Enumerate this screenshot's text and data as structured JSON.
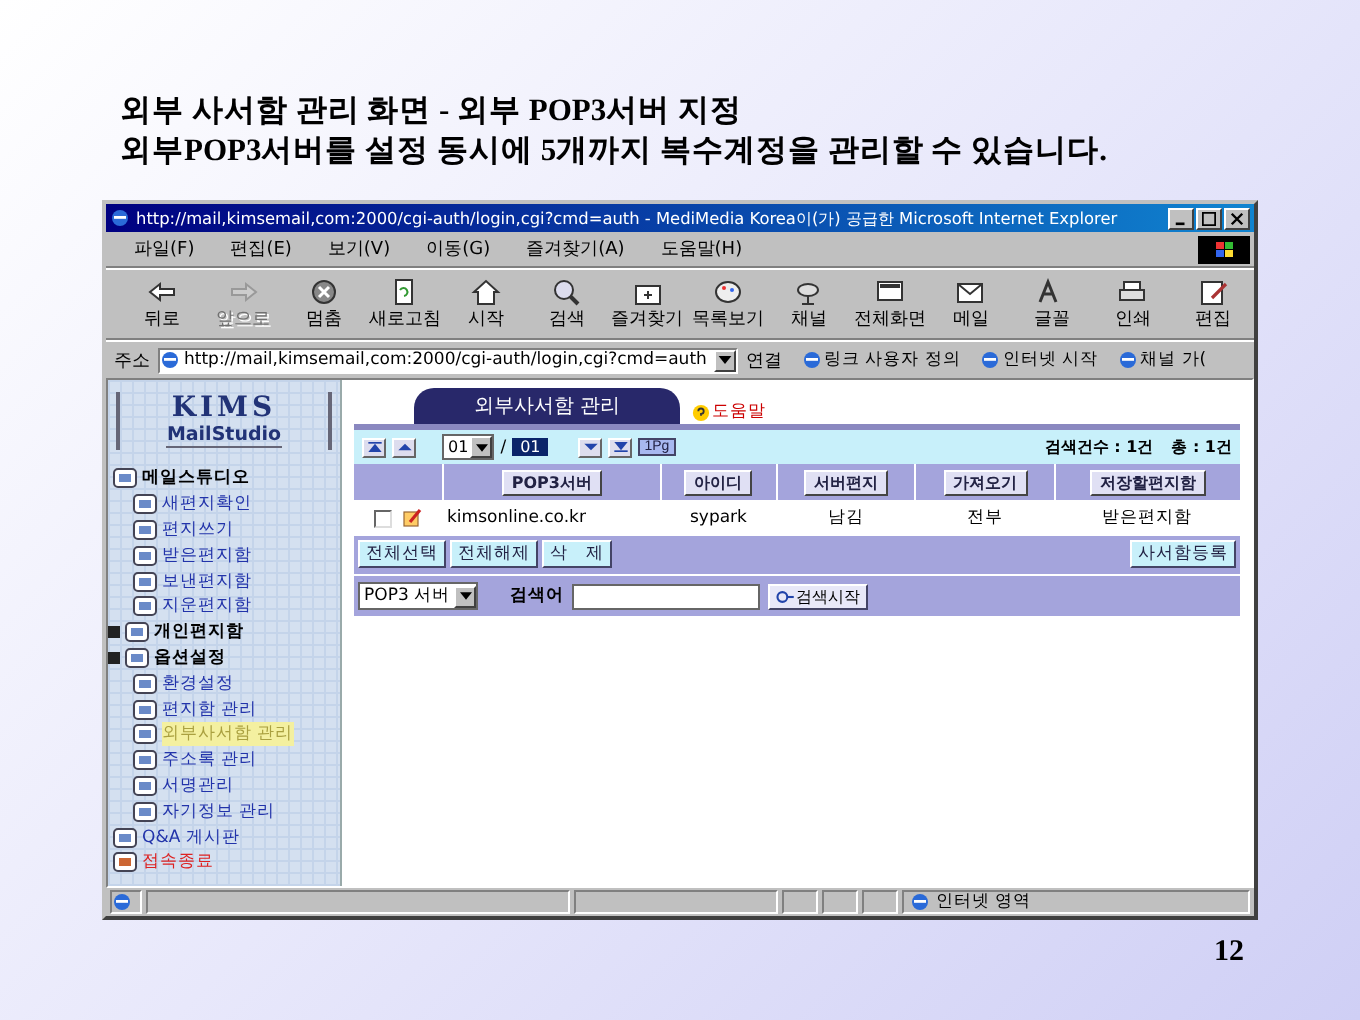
{
  "slide": {
    "title_lines": [
      "외부 사서함 관리 화면 - 외부 POP3서버 지정",
      "외부POP3서버를 설정 동시에 5개까지 복수계정을 관리할 수 있습니다."
    ],
    "page_number": "12"
  },
  "window": {
    "title": "http://mail,kimsemail,com:2000/cgi-auth/login,cgi?cmd=auth - MediMedia Korea이(가) 공급한 Microsoft Internet Explorer",
    "menu": [
      "파일(F)",
      "편집(E)",
      "보기(V)",
      "이동(G)",
      "즐겨찾기(A)",
      "도움말(H)"
    ],
    "toolbar": [
      {
        "label": "뒤로",
        "disabled": false
      },
      {
        "label": "앞으로",
        "disabled": true
      },
      {
        "label": "멈춤",
        "disabled": false
      },
      {
        "label": "새로고침",
        "disabled": false
      },
      {
        "label": "시작",
        "disabled": false
      },
      {
        "label": "검색",
        "disabled": false
      },
      {
        "label": "즐겨찾기",
        "disabled": false
      },
      {
        "label": "목록보기",
        "disabled": false
      },
      {
        "label": "채널",
        "disabled": false
      },
      {
        "label": "전체화면",
        "disabled": false
      },
      {
        "label": "메일",
        "disabled": false
      },
      {
        "label": "글꼴",
        "disabled": false
      },
      {
        "label": "인쇄",
        "disabled": false
      },
      {
        "label": "편집",
        "disabled": false
      }
    ],
    "address": {
      "label": "주소",
      "url": "http://mail,kimsemail,com:2000/cgi-auth/login,cgi?cmd=auth"
    },
    "go_label": "연결",
    "links": [
      "링크 사용자 정의",
      "인터넷 시작",
      "채널 가("
    ],
    "status": "인터넷 영역"
  },
  "sidebar": {
    "logo": {
      "line1": "KIMS",
      "line2": "MailStudio"
    },
    "tree": [
      {
        "label": "메일스튜디오",
        "kind": "group",
        "selected": false,
        "children": [
          {
            "label": "새편지확인",
            "kind": "link",
            "selected": false
          },
          {
            "label": "편지쓰기",
            "kind": "link",
            "selected": false
          },
          {
            "label": "받은편지함",
            "kind": "link",
            "selected": false
          },
          {
            "label": "보낸편지함",
            "kind": "link",
            "selected": false
          },
          {
            "label": "지운편지함",
            "kind": "link",
            "selected": false
          }
        ]
      },
      {
        "label": "개인편지함",
        "kind": "group",
        "toggle": true,
        "selected": false
      },
      {
        "label": "옵션설정",
        "kind": "group",
        "toggle": true,
        "selected": false,
        "children": [
          {
            "label": "환경설정",
            "kind": "link",
            "selected": false
          },
          {
            "label": "편지함 관리",
            "kind": "link",
            "selected": false
          },
          {
            "label": "외부사서함 관리",
            "kind": "link",
            "selected": true
          },
          {
            "label": "주소록 관리",
            "kind": "link",
            "selected": false
          },
          {
            "label": "서명관리",
            "kind": "link",
            "selected": false
          },
          {
            "label": "자기정보 관리",
            "kind": "link",
            "selected": false
          }
        ]
      },
      {
        "label": "Q&A 게시판",
        "kind": "link",
        "selected": false
      },
      {
        "label": "접속종료",
        "kind": "exit",
        "selected": false
      }
    ]
  },
  "main": {
    "tab_title": "외부사서함 관리",
    "help": "도움말",
    "pager": {
      "page": "01",
      "separator": "/",
      "total_pages": "01",
      "page_button": "1Pg",
      "found": "검색건수 : 1건",
      "total": "총 : 1건"
    },
    "table": {
      "columns": [
        "POP3서버",
        "아이디",
        "서버편지",
        "가져오기",
        "저장할편지함"
      ],
      "rows": [
        {
          "checked": false,
          "cells": [
            "kimsonline.co.kr",
            "sypark",
            "남김",
            "전부",
            "받은편지함"
          ]
        }
      ]
    },
    "actions": [
      "전체선택",
      "전체해제",
      "삭　제"
    ],
    "register": "사서함등록",
    "search": {
      "field": "POP3 서버",
      "label": "검색어",
      "button": "검색시작"
    }
  }
}
